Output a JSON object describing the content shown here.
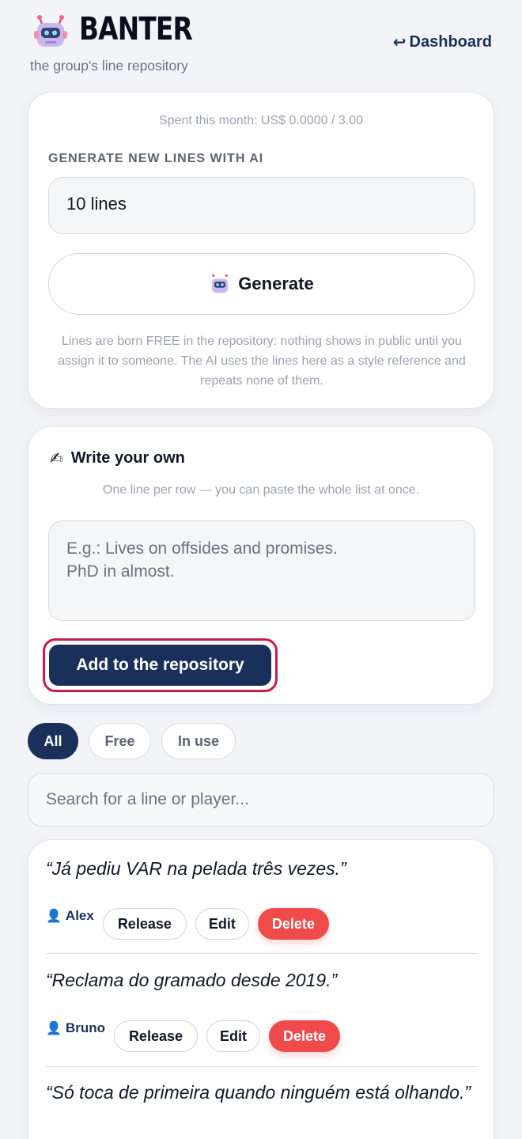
{
  "header": {
    "brand": "BANTER",
    "tagline": "the group's line repository",
    "dashboard_link": "Dashboard",
    "logo_icon": "robot-icon"
  },
  "generator": {
    "spent": "Spent this month: US$ 0.0000 / 3.00",
    "section_label": "GENERATE NEW LINES WITH AI",
    "count_value": "10 lines",
    "generate_label": "Generate",
    "note": "Lines are born FREE in the repository: nothing shows in public until you assign it to someone. The AI uses the lines here as a style reference and repeats none of them."
  },
  "write": {
    "title": "Write your own",
    "title_icon": "writing-hand-icon",
    "subtitle": "One line per row — you can paste the whole list at once.",
    "placeholder": "E.g.: Lives on offsides and promises.\nPhD in almost.",
    "add_label": "Add to the repository"
  },
  "filters": {
    "all": "All",
    "free": "Free",
    "in_use": "In use",
    "active": "All"
  },
  "search": {
    "placeholder": "Search for a line or player..."
  },
  "lines": [
    {
      "text": "“Já pediu VAR na pelada três vezes.”",
      "player": "Alex",
      "release": "Release",
      "edit": "Edit",
      "delete": "Delete"
    },
    {
      "text": "“Reclama do gramado desde 2019.”",
      "player": "Bruno",
      "release": "Release",
      "edit": "Edit",
      "delete": "Delete"
    },
    {
      "text": "“Só toca de primeira quando ninguém está olhando.”"
    }
  ],
  "colors": {
    "primary": "#1b2f5b",
    "danger": "#ef4b4b",
    "focus_ring": "#d0184a",
    "background": "#f3f4f8"
  }
}
